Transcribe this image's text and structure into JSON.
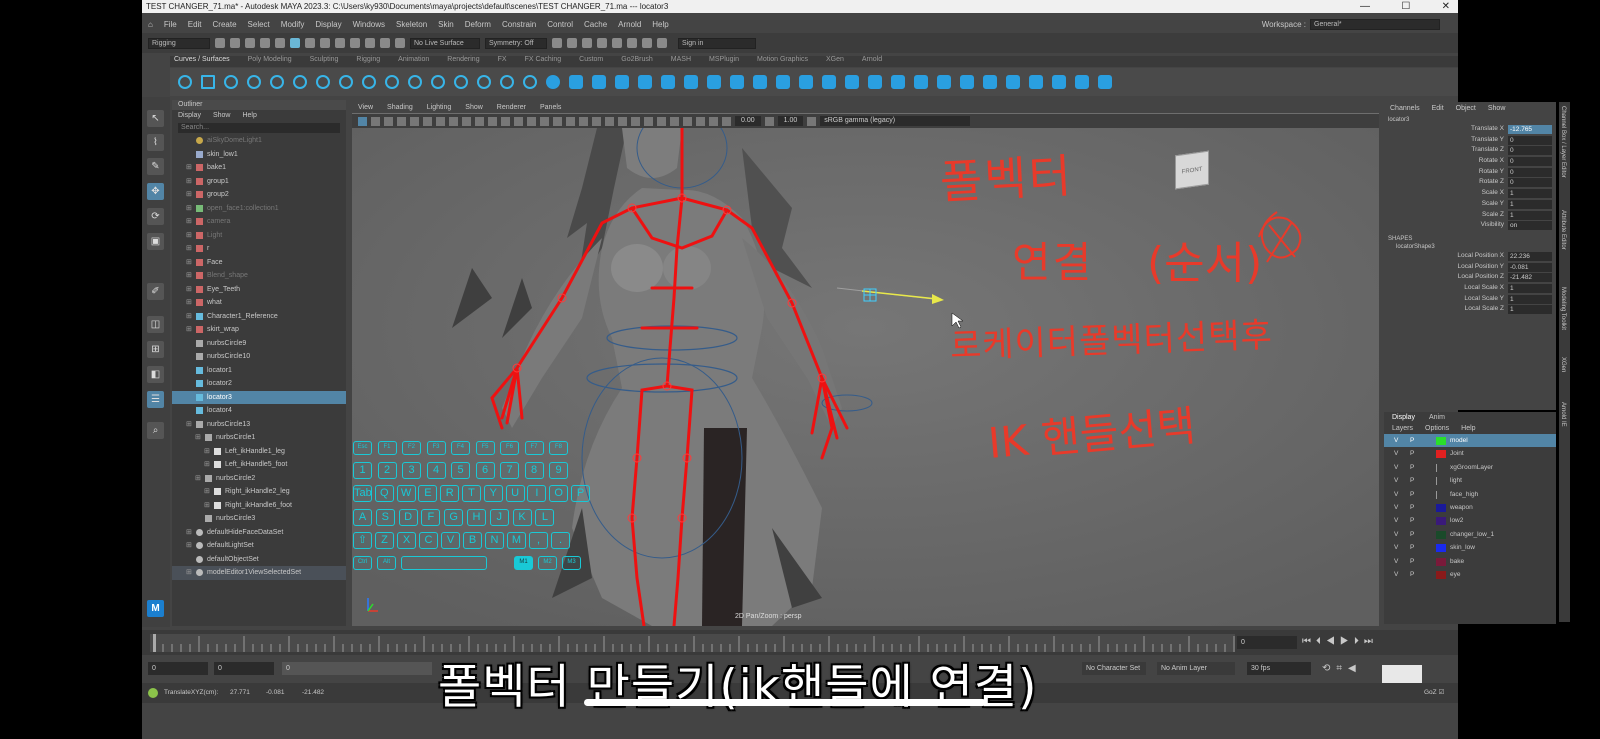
{
  "window": {
    "title": "TEST CHANGER_71.ma* - Autodesk MAYA 2023.3: C:\\Users\\ky930\\Documents\\maya\\projects\\default\\scenes\\TEST CHANGER_71.ma   ---   locator3",
    "controls": [
      "—",
      "☐",
      "✕"
    ]
  },
  "menubar": {
    "items": [
      "File",
      "Edit",
      "Create",
      "Select",
      "Modify",
      "Display",
      "Windows",
      "Skeleton",
      "Skin",
      "Deform",
      "Constrain",
      "Control",
      "Cache",
      "Arnold",
      "Help"
    ],
    "workspace_label": "Workspace :",
    "workspace_value": "General*"
  },
  "statusline": {
    "menuset": "Rigging",
    "live_surface": "No Live Surface",
    "symmetry": "Symmetry: Off",
    "signin": "Sign in"
  },
  "shelf": {
    "tabs": [
      "Curves / Surfaces",
      "Poly Modeling",
      "Sculpting",
      "Rigging",
      "Animation",
      "Rendering",
      "FX",
      "FX Caching",
      "Custom",
      "Go2Brush",
      "MASH",
      "MSPlugin",
      "Motion Graphics",
      "XGen",
      "Arnold"
    ],
    "active_tab": "Curves / Surfaces"
  },
  "outliner": {
    "title": "Outliner",
    "menu": [
      "Display",
      "Show",
      "Help"
    ],
    "search_placeholder": "Search...",
    "rows": [
      {
        "label": "aiSkyDomeLight1",
        "indent": 0,
        "icon": "light",
        "dim": true
      },
      {
        "label": "skin_low1",
        "indent": 0,
        "icon": "mesh"
      },
      {
        "label": "bake1",
        "indent": 0,
        "icon": "group",
        "expand": true
      },
      {
        "label": "group1",
        "indent": 0,
        "icon": "group",
        "expand": true
      },
      {
        "label": "group2",
        "indent": 0,
        "icon": "group",
        "expand": true
      },
      {
        "label": "open_face1:collection1",
        "indent": 0,
        "icon": "collection",
        "expand": true,
        "dim": true
      },
      {
        "label": "camera",
        "indent": 0,
        "icon": "group",
        "expand": true,
        "dim": true
      },
      {
        "label": "Light",
        "indent": 0,
        "icon": "group",
        "expand": true,
        "dim": true
      },
      {
        "label": "r",
        "indent": 0,
        "icon": "group",
        "expand": true
      },
      {
        "label": "Face",
        "indent": 0,
        "icon": "group",
        "expand": true
      },
      {
        "label": "Blend_shape",
        "indent": 0,
        "icon": "group",
        "expand": true,
        "dim": true
      },
      {
        "label": "Eye_Teeth",
        "indent": 0,
        "icon": "group",
        "expand": true
      },
      {
        "label": "what",
        "indent": 0,
        "icon": "group",
        "expand": true
      },
      {
        "label": "Character1_Reference",
        "indent": 0,
        "icon": "joint",
        "expand": true
      },
      {
        "label": "skirt_wrap",
        "indent": 0,
        "icon": "group",
        "expand": true
      },
      {
        "label": "nurbsCircle9",
        "indent": 0,
        "icon": "curve"
      },
      {
        "label": "nurbsCircle10",
        "indent": 0,
        "icon": "curve"
      },
      {
        "label": "locator1",
        "indent": 0,
        "icon": "locator"
      },
      {
        "label": "locator2",
        "indent": 0,
        "icon": "locator"
      },
      {
        "label": "locator3",
        "indent": 0,
        "icon": "locator",
        "selected": true
      },
      {
        "label": "locator4",
        "indent": 0,
        "icon": "locator"
      },
      {
        "label": "nurbsCircle13",
        "indent": 0,
        "icon": "curve",
        "expand": true
      },
      {
        "label": "nurbsCircle1",
        "indent": 1,
        "icon": "curve",
        "expand": true
      },
      {
        "label": "Left_ikHandle1_leg",
        "indent": 2,
        "icon": "ik",
        "expand": true
      },
      {
        "label": "Left_ikHandle5_foot",
        "indent": 2,
        "icon": "ik",
        "expand": true
      },
      {
        "label": "nurbsCircle2",
        "indent": 1,
        "icon": "curve",
        "expand": true
      },
      {
        "label": "Right_ikHandle2_leg",
        "indent": 2,
        "icon": "ik",
        "expand": true
      },
      {
        "label": "Right_ikHandle6_foot",
        "indent": 2,
        "icon": "ik",
        "expand": true
      },
      {
        "label": "nurbsCircle3",
        "indent": 1,
        "icon": "curve"
      },
      {
        "label": "defaultHideFaceDataSet",
        "indent": 0,
        "icon": "set",
        "expand": true
      },
      {
        "label": "defaultLightSet",
        "indent": 0,
        "icon": "set",
        "expand": true
      },
      {
        "label": "defaultObjectSet",
        "indent": 0,
        "icon": "set"
      },
      {
        "label": "modelEditor1ViewSelectedSet",
        "indent": 0,
        "icon": "set",
        "expand": true,
        "highlight": true
      }
    ]
  },
  "viewport": {
    "menu": [
      "View",
      "Shading",
      "Lighting",
      "Show",
      "Renderer",
      "Panels"
    ],
    "field_a": "0.00",
    "field_b": "1.00",
    "colorspace": "sRGB gamma (legacy)",
    "camera_label": "2D Pan/Zoom : persp",
    "viewcube_label": "FRONT"
  },
  "keyboard_overlay": {
    "fn_row": [
      "Esc",
      "F1",
      "F2",
      "F3",
      "F4",
      "F5",
      "F6",
      "F7",
      "F8"
    ],
    "num_row": [
      "1",
      "2",
      "3",
      "4",
      "5",
      "6",
      "7",
      "8",
      "9"
    ],
    "row_q": [
      "Tab",
      "Q",
      "W",
      "E",
      "R",
      "T",
      "Y",
      "U",
      "I",
      "O",
      "P"
    ],
    "row_a": [
      "A",
      "S",
      "D",
      "F",
      "G",
      "H",
      "J",
      "K",
      "L"
    ],
    "row_z": [
      "⇧",
      "Z",
      "X",
      "C",
      "V",
      "B",
      "N",
      "M",
      ",",
      "."
    ],
    "bottom_left": [
      "Ctrl",
      "Alt"
    ],
    "mouse": [
      "M1",
      "M2",
      "M3"
    ]
  },
  "annotations": [
    "폴벡터",
    "연결",
    "(순서)",
    "로케이터폴벡터선택후",
    "IK 핸들선택"
  ],
  "channel_box": {
    "tabs": [
      "Channels",
      "Edit",
      "Object",
      "Show"
    ],
    "object": "locator3",
    "channels": [
      {
        "name": "Translate X",
        "value": "-12.765",
        "hl": true
      },
      {
        "name": "Translate Y",
        "value": "0"
      },
      {
        "name": "Translate Z",
        "value": "0"
      },
      {
        "name": "Rotate X",
        "value": "0"
      },
      {
        "name": "Rotate Y",
        "value": "0"
      },
      {
        "name": "Rotate Z",
        "value": "0"
      },
      {
        "name": "Scale X",
        "value": "1"
      },
      {
        "name": "Scale Y",
        "value": "1"
      },
      {
        "name": "Scale Z",
        "value": "1"
      },
      {
        "name": "Visibility",
        "value": "on"
      }
    ],
    "shapes_label": "SHAPES",
    "shape_name": "locatorShape3",
    "shape_channels": [
      {
        "name": "Local Position X",
        "value": "22.236"
      },
      {
        "name": "Local Position Y",
        "value": "-0.081"
      },
      {
        "name": "Local Position Z",
        "value": "-21.482"
      },
      {
        "name": "Local Scale X",
        "value": "1"
      },
      {
        "name": "Local Scale Y",
        "value": "1"
      },
      {
        "name": "Local Scale Z",
        "value": "1"
      }
    ]
  },
  "side_tabs": [
    "Channel Box / Layer Editor",
    "Attribute Editor",
    "Modeling Toolkit",
    "XGen",
    "Arnold IE"
  ],
  "layers": {
    "tabs": [
      "Display",
      "Anim"
    ],
    "menu": [
      "Layers",
      "Options",
      "Help"
    ],
    "rows": [
      {
        "v": "V",
        "p": "P",
        "color": "#2ae02a",
        "name": "model",
        "selected": true
      },
      {
        "v": "V",
        "p": "P",
        "color": "#e02020",
        "name": "Joint"
      },
      {
        "v": "V",
        "p": "P",
        "color": "",
        "name": "xgGroomLayer"
      },
      {
        "v": "V",
        "p": "P",
        "color": "",
        "name": "light"
      },
      {
        "v": "V",
        "p": "P",
        "color": "",
        "name": "face_high"
      },
      {
        "v": "V",
        "p": "P",
        "color": "#1a1a9a",
        "name": "weapon"
      },
      {
        "v": "V",
        "p": "P",
        "color": "#3a1a7a",
        "name": "low2"
      },
      {
        "v": "V",
        "p": "P",
        "color": "#1a4a2a",
        "name": "changer_low_1"
      },
      {
        "v": "V",
        "p": "P",
        "color": "#1a2aee",
        "name": "skin_low"
      },
      {
        "v": "V",
        "p": "P",
        "color": "#7a1a3a",
        "name": "bake"
      },
      {
        "v": "V",
        "p": "P",
        "color": "#8a1a1a",
        "name": "eye"
      }
    ]
  },
  "timeline": {
    "current_frame": "0",
    "range_start": "0",
    "range_start2": "0",
    "range_mid": "0",
    "character_set": "No Character Set",
    "anim_layer": "No Anim Layer",
    "fps": "30 fps"
  },
  "cmdline": {
    "label": "TranslateXYZ(cm):",
    "x": "27.771",
    "y": "-0.081",
    "z": "-21.482",
    "goz": "GoZ ☑"
  },
  "subtitle": "폴벡터 만들기(ik핸들에 연결)"
}
